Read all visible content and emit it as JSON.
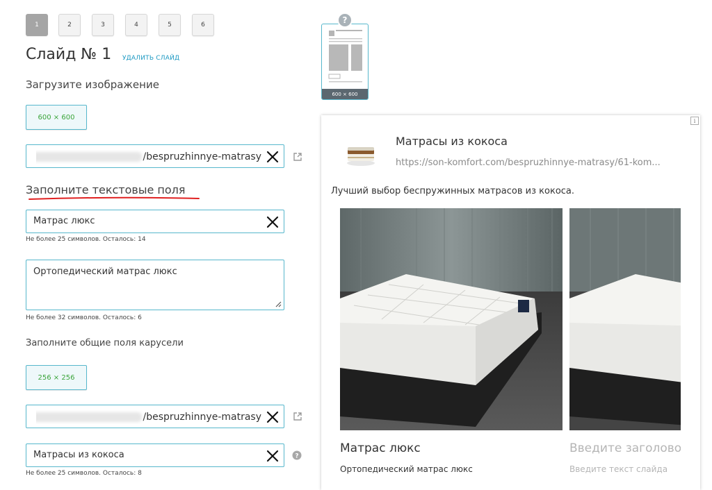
{
  "tabs": [
    {
      "label": "1",
      "active": true
    },
    {
      "label": "2",
      "active": false
    },
    {
      "label": "3",
      "active": false
    },
    {
      "label": "4",
      "active": false
    },
    {
      "label": "5",
      "active": false
    },
    {
      "label": "6",
      "active": false
    }
  ],
  "slide": {
    "title": "Слайд № 1",
    "delete_label": "удалить слайд"
  },
  "upload": {
    "label": "Загрузите изображение",
    "size_button": "600 × 600"
  },
  "url_field": {
    "value_suffix": "/bespruzhinnye-matrasy"
  },
  "text_fields": {
    "label": "Заполните текстовые поля",
    "title_value": "Матрас люкс",
    "title_hint": "Не более 25 символов. Осталось: 14",
    "text_value": "Ортопедический матрас люкс",
    "text_hint": "Не более 32 символов. Осталось: 6"
  },
  "carousel": {
    "label": "Заполните общие поля карусели",
    "size_button": "256 × 256",
    "url_value_suffix": "/bespruzhinnye-matrasy",
    "title_value": "Матрасы из кокоса",
    "title_hint": "Не более 25 символов. Осталось: 8"
  },
  "preview": {
    "help_icon": "?",
    "thumb_size_label": "600 × 600",
    "info_icon": "i",
    "ad_title": "Матрасы из кокоса",
    "ad_url": "https://son-komfort.com/bespruzhinnye-matrasy/61-kom...",
    "ad_description": "Лучший выбор беспружинных матрасов из кокоса.",
    "slide1_title": "Матрас люкс",
    "slide1_text": "Ортопедический матрас люкс",
    "slide2_title_placeholder": "Введите заголовок",
    "slide2_text_placeholder": "Введите текст слайда"
  },
  "colors": {
    "accent_border": "#56b7cc",
    "link": "#1a98c2",
    "size_text": "#3aa43a",
    "underline": "#e02020"
  }
}
